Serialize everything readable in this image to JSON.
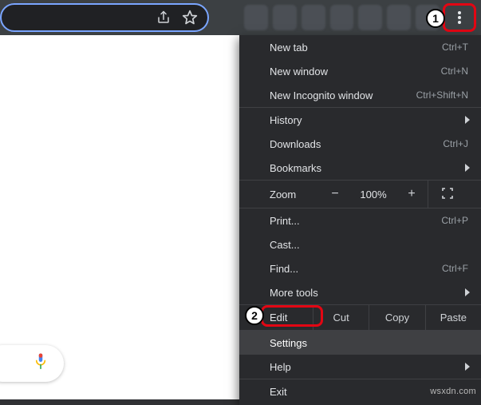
{
  "omnibox": {
    "share_icon": "share-icon",
    "star_icon": "star-icon"
  },
  "kebab_icon": "kebab-menu-icon",
  "badges": {
    "one": "1",
    "two": "2"
  },
  "menu": {
    "group1": [
      {
        "label": "New tab",
        "shortcut": "Ctrl+T"
      },
      {
        "label": "New window",
        "shortcut": "Ctrl+N"
      },
      {
        "label": "New Incognito window",
        "shortcut": "Ctrl+Shift+N"
      }
    ],
    "group2": [
      {
        "label": "History",
        "submenu": true
      },
      {
        "label": "Downloads",
        "shortcut": "Ctrl+J"
      },
      {
        "label": "Bookmarks",
        "submenu": true
      }
    ],
    "zoom": {
      "label": "Zoom",
      "minus": "−",
      "value": "100%",
      "plus": "+"
    },
    "group3": [
      {
        "label": "Print...",
        "shortcut": "Ctrl+P"
      },
      {
        "label": "Cast..."
      },
      {
        "label": "Find...",
        "shortcut": "Ctrl+F"
      },
      {
        "label": "More tools",
        "submenu": true
      }
    ],
    "edit": {
      "label": "Edit",
      "cut": "Cut",
      "copy": "Copy",
      "paste": "Paste"
    },
    "group4": [
      {
        "label": "Settings",
        "hover": true
      },
      {
        "label": "Help",
        "submenu": true
      }
    ],
    "group5": [
      {
        "label": "Exit"
      }
    ]
  },
  "watermark": "wsxdn.com"
}
